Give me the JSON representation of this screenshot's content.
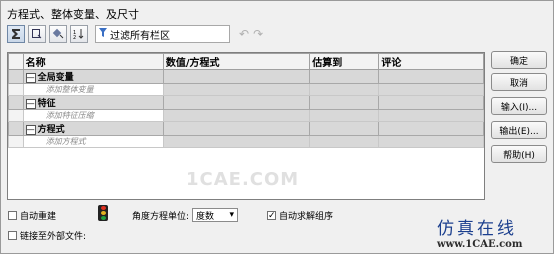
{
  "window": {
    "title": "方程式、整体变量、及尺寸"
  },
  "toolbar": {
    "filter_text": "过滤所有栏区",
    "buttons": [
      "sigma-view-icon",
      "dimension-view-icon",
      "sort-view-icon",
      "order-view-icon"
    ]
  },
  "table": {
    "columns": [
      "名称",
      "数值/方程式",
      "估算到",
      "评论"
    ],
    "groups": [
      {
        "label": "全局变量",
        "hint": "添加整体变量"
      },
      {
        "label": "特征",
        "hint": "添加特征压缩"
      },
      {
        "label": "方程式",
        "hint": "添加方程式"
      }
    ],
    "collapse_symbol": "—"
  },
  "watermark": "1CAE.COM",
  "buttons": {
    "ok": "确定",
    "cancel": "取消",
    "import": "输入(I)...",
    "export": "输出(E)...",
    "help": "帮助(H)"
  },
  "bottom": {
    "auto_rebuild": "自动重建",
    "auto_rebuild_checked": false,
    "angle_unit_label": "角度方程单位:",
    "angle_unit_value": "度数",
    "auto_solve_order": "自动求解组序",
    "auto_solve_order_checked": true,
    "link_external": "链接至外部文件:",
    "link_external_checked": false,
    "check_mark": "✓"
  },
  "branding": {
    "cn": "仿真在线",
    "url": "www.1CAE.com"
  },
  "colors": {
    "brand_blue": "#1b3f8e",
    "group_row": "#d8d8d8"
  }
}
